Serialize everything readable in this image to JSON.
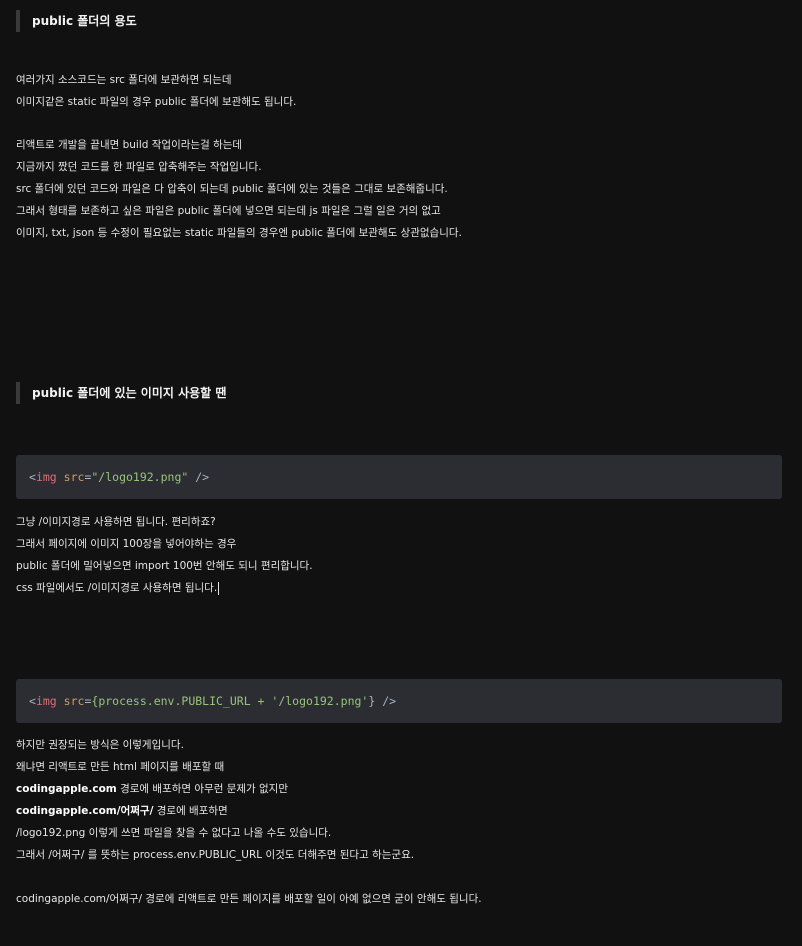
{
  "section1": {
    "heading": "public 폴더의 용도",
    "para1": [
      "여러가지 소스코드는 src 폴더에 보관하면 되는데",
      "이미지같은 static 파일의 경우 public 폴더에 보관해도 됩니다."
    ],
    "para2": [
      "리액트로 개발을 끝내면 build 작업이라는걸 하는데",
      "지금까지 짰던 코드를 한 파일로 압축해주는 작업입니다.",
      "src 폴더에 있던 코드와 파일은 다 압축이 되는데 public 폴더에 있는 것들은 그대로 보존해줍니다.",
      "그래서 형태를 보존하고 싶은 파일은 public 폴더에 넣으면 되는데 js 파일은 그럴 일은 거의 없고",
      "이미지, txt, json 등 수정이 필요없는 static 파일들의 경우엔 public 폴더에 보관해도 상관없습니다."
    ]
  },
  "section2": {
    "heading": "public 폴더에 있는 이미지 사용할 땐",
    "code1": {
      "open": "<",
      "tag": "img",
      "attr": "src",
      "eq": "=",
      "value": "\"/logo192.png\"",
      "close": " />"
    },
    "para1": [
      "그냥 /이미지경로 사용하면 됩니다. 편리하죠?",
      "그래서 페이지에 이미지 100장을 넣어야하는 경우",
      "public 폴더에 밀어넣으면 import 100번 안해도 되니 편리합니다.",
      "css 파일에서도 /이미지경로 사용하면 됩니다."
    ],
    "code2": {
      "open": "<",
      "tag": "img",
      "attr": "src",
      "eq": "=",
      "brace_open": "{",
      "expr": "process.env.PUBLIC_URL + ",
      "value": "'/logo192.png'",
      "brace_close": "}",
      "close": " />"
    },
    "para2": {
      "l1": "하지만 권장되는 방식은 이렇게입니다.",
      "l2": "왜냐면 리액트로 만든 html 페이지를 배포할 때",
      "l3_bold": "codingapple.com",
      "l3_rest": " 경로에 배포하면 아무런 문제가 없지만",
      "l4_bold": "codingapple.com/어쩌구/",
      "l4_rest": " 경로에 배포하면",
      "l5": "/logo192.png 이렇게 쓰면 파일을 찾을 수 없다고 나올 수도 있습니다.",
      "l6": "그래서 /어쩌구/ 를 뜻하는 process.env.PUBLIC_URL 이것도 더해주면 된다고 하는군요."
    },
    "para3": "codingapple.com/어쩌구/ 경로에 리액트로 만든 페이지를 배포할 일이 아예 없으면 굳이 안해도 됩니다."
  }
}
